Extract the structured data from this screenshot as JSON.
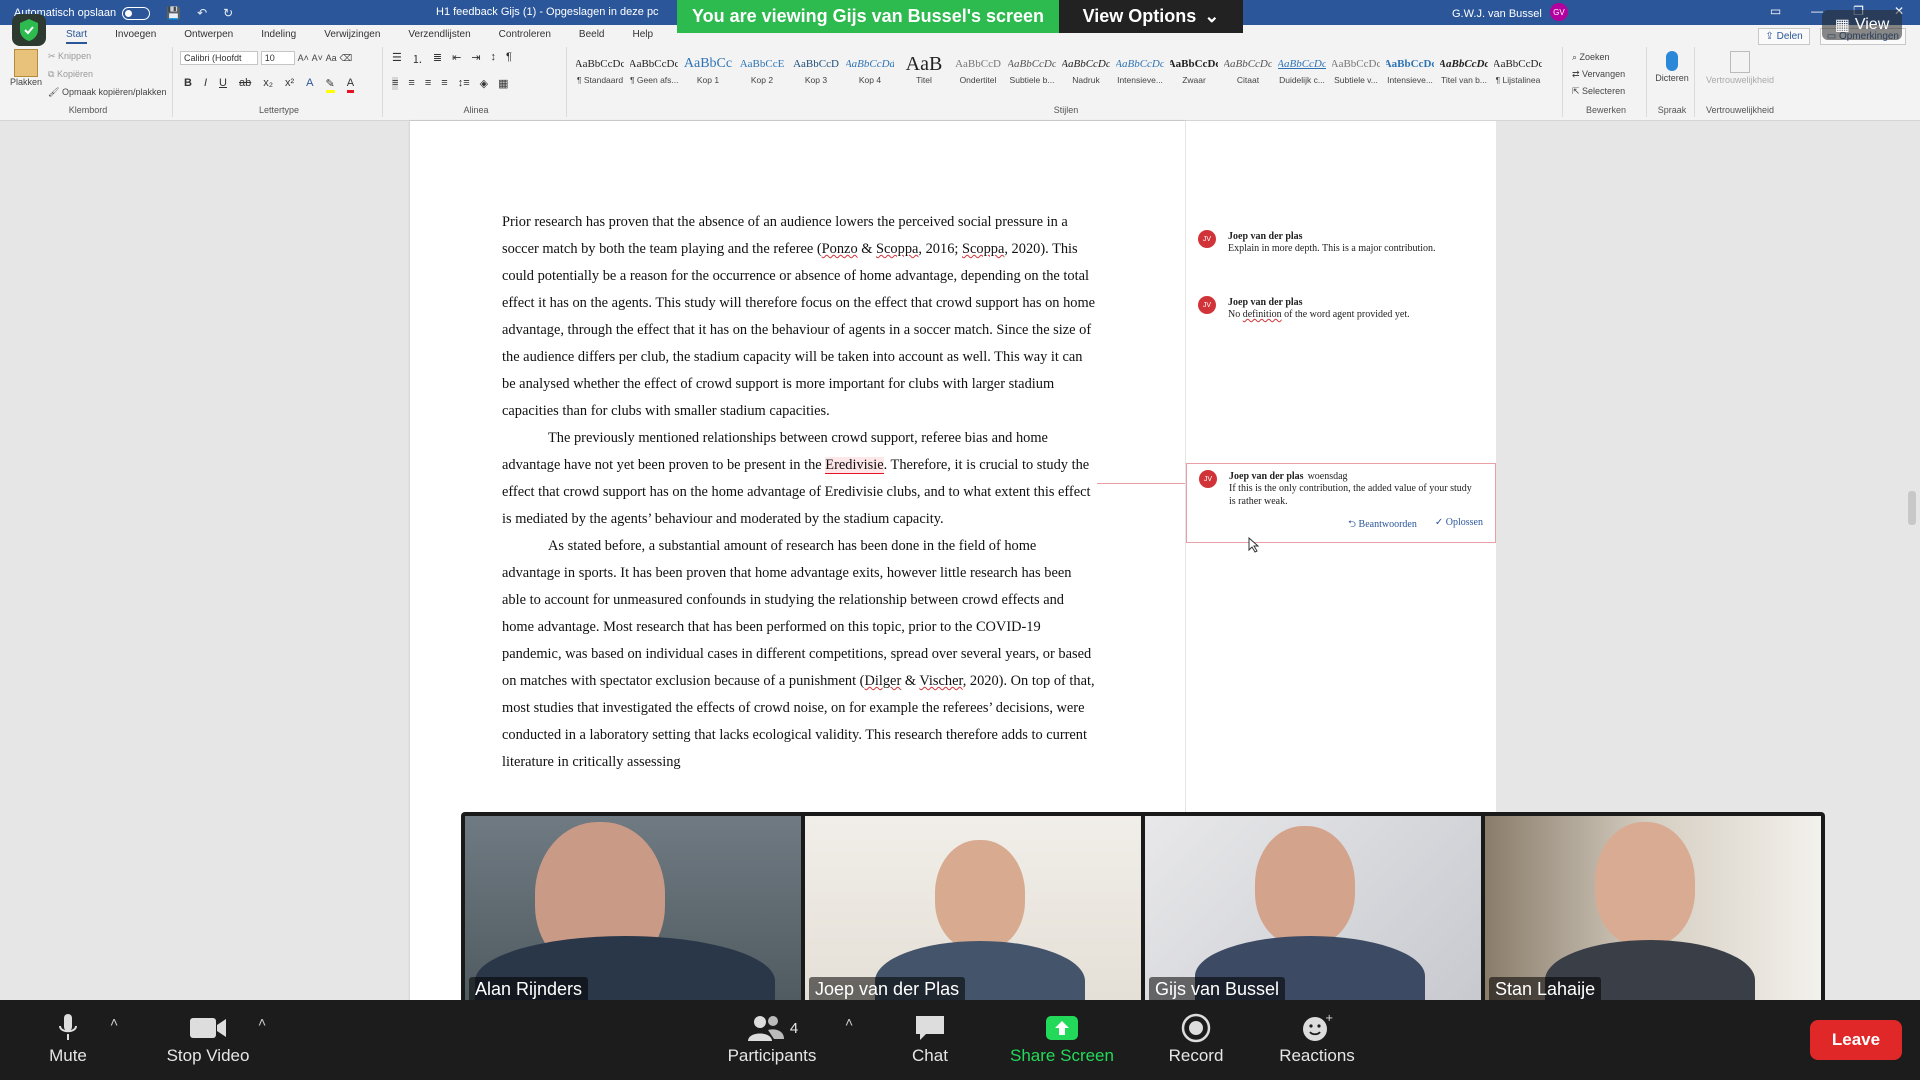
{
  "word": {
    "autosave_label": "Automatisch opslaan",
    "doc_title": "H1 feedback Gijs (1)  -  Opgeslagen in deze pc",
    "user_name": "G.W.J. van Bussel",
    "user_initials": "GV",
    "tabs": [
      "Start",
      "Invoegen",
      "Ontwerpen",
      "Indeling",
      "Verwijzingen",
      "Verzendlijsten",
      "Controleren",
      "Beeld",
      "Help"
    ],
    "share_label": "Delen",
    "comments_label": "Opmerkingen",
    "clipboard": {
      "paste": "Plakken",
      "cut": "Knippen",
      "copy": "Kopiëren",
      "format_painter": "Opmaak kopiëren/plakken",
      "group": "Klembord"
    },
    "font": {
      "name": "Calibri (Hoofdt",
      "size": "10",
      "group": "Lettertype"
    },
    "paragraph_group": "Alinea",
    "styles_group": "Stijlen",
    "styles": [
      {
        "preview": "AaBbCcDc",
        "name": "¶ Standaard"
      },
      {
        "preview": "AaBbCcDc",
        "name": "¶ Geen afs..."
      },
      {
        "preview": "AaBbCc",
        "name": "Kop 1"
      },
      {
        "preview": "AaBbCcE",
        "name": "Kop 2"
      },
      {
        "preview": "AaBbCcD",
        "name": "Kop 3"
      },
      {
        "preview": "AaBbCcDd",
        "name": "Kop 4"
      },
      {
        "preview": "AaB",
        "name": "Titel"
      },
      {
        "preview": "AaBbCcD",
        "name": "Ondertitel"
      },
      {
        "preview": "AaBbCcDc",
        "name": "Subtiele b..."
      },
      {
        "preview": "AaBbCcDc",
        "name": "Nadruk"
      },
      {
        "preview": "AaBbCcDc",
        "name": "Intensieve..."
      },
      {
        "preview": "AaBbCcDc",
        "name": "Zwaar"
      },
      {
        "preview": "AaBbCcDc",
        "name": "Citaat"
      },
      {
        "preview": "AaBbCcDc",
        "name": "Duidelijk c..."
      },
      {
        "preview": "AaBbCcDc",
        "name": "Subtiele v..."
      },
      {
        "preview": "AaBbCcDc",
        "name": "Intensieve..."
      },
      {
        "preview": "AaBbCcDc",
        "name": "Titel van b..."
      },
      {
        "preview": "AaBbCcDc",
        "name": "¶ Lijstalinea"
      }
    ],
    "editing": {
      "find": "Zoeken",
      "replace": "Vervangen",
      "select": "Selecteren",
      "group": "Bewerken"
    },
    "dictate": {
      "label": "Dicteren",
      "group": "Spraak"
    },
    "sensitivity": {
      "label": "Vertrouwelijkheid",
      "group": "Vertrouwelijkheid"
    }
  },
  "document": {
    "p1": {
      "t1": "Prior research has proven that the absence of an audience lowers the perceived social pressure in a soccer match by both the team playing and the referee (",
      "s1": "Ponzo",
      "t2": " & ",
      "s2": "Scoppa",
      "t3": ", 2016; ",
      "s3": "Scoppa",
      "t4": ", 2020). This could potentially be a reason for the occurrence or absence of home advantage, depending on the total effect it has on the agents. This study will therefore focus on the effect that crowd support has on home advantage, through the effect that it has on the behaviour of agents in a soccer match. Since the size of the audience differs per club, the stadium capacity will be taken into account as well. This way it can be analysed whether the effect of crowd support is more important for clubs with larger stadium capacities than for clubs with smaller stadium capacities."
    },
    "p2": {
      "t1": "The previously mentioned relationships between crowd support, referee bias and home advantage have not yet been proven to be present in the ",
      "hl": "Eredivisie",
      "t2": ". Therefore, it is crucial to study the effect that crowd support has on the home advantage of Eredivisie clubs, and to what extent this effect is mediated by the agents’ behaviour and moderated by the stadium capacity."
    },
    "p3": {
      "t1": "As stated before, a substantial amount of research has been done in the field of home advantage in sports. It has been proven that home advantage exits, however little research has been able to account for unmeasured confounds in studying the relationship between crowd effects and home advantage. Most research that has been performed on this topic, prior to the COVID-19 pandemic, was based on individual cases in different competitions, spread over several years, or based on matches with spectator exclusion because of a punishment (",
      "s1": "Dilger",
      "t2": " & ",
      "s2": "Vischer",
      "t3": ", 2020). On top of that, most studies that investigated the effects of crowd noise, on for example the referees’ decisions, were conducted in a laboratory setting that lacks ecological validity. This research therefore adds to current literature in critically assessing"
    }
  },
  "comments": [
    {
      "initials": "JV",
      "author": "Joep van der plas",
      "date": "",
      "text": "Explain in more depth. This is a major contribution."
    },
    {
      "initials": "JV",
      "author": "Joep van der plas",
      "date": "",
      "text_pre": "No ",
      "text_sq": "definition",
      "text_post": " of the word agent provided yet."
    },
    {
      "initials": "JV",
      "author": "Joep van der plas",
      "date": "woensdag",
      "text": "If this is the only contribution, the added value of your study is rather weak.",
      "reply_label": "Beantwoorden",
      "resolve_label": "Oplossen"
    }
  ],
  "zoom": {
    "banner_text": "You are viewing Gijs van Bussel's screen",
    "view_options_label": "View Options",
    "view_label": "View",
    "participants": [
      {
        "name": "Alan Rijnders"
      },
      {
        "name": "Joep van der Plas"
      },
      {
        "name": "Gijs van Bussel"
      },
      {
        "name": "Stan Lahaije"
      }
    ],
    "controls": {
      "mute": "Mute",
      "stop_video": "Stop Video",
      "participants": "Participants",
      "participants_count": "4",
      "chat": "Chat",
      "share_screen": "Share Screen",
      "record": "Record",
      "reactions": "Reactions",
      "leave": "Leave"
    },
    "colors": {
      "banner_green": "#2dba4e",
      "leave_red": "#e02828",
      "share_green": "#23d959",
      "speaking_border": "#a0d911"
    }
  }
}
